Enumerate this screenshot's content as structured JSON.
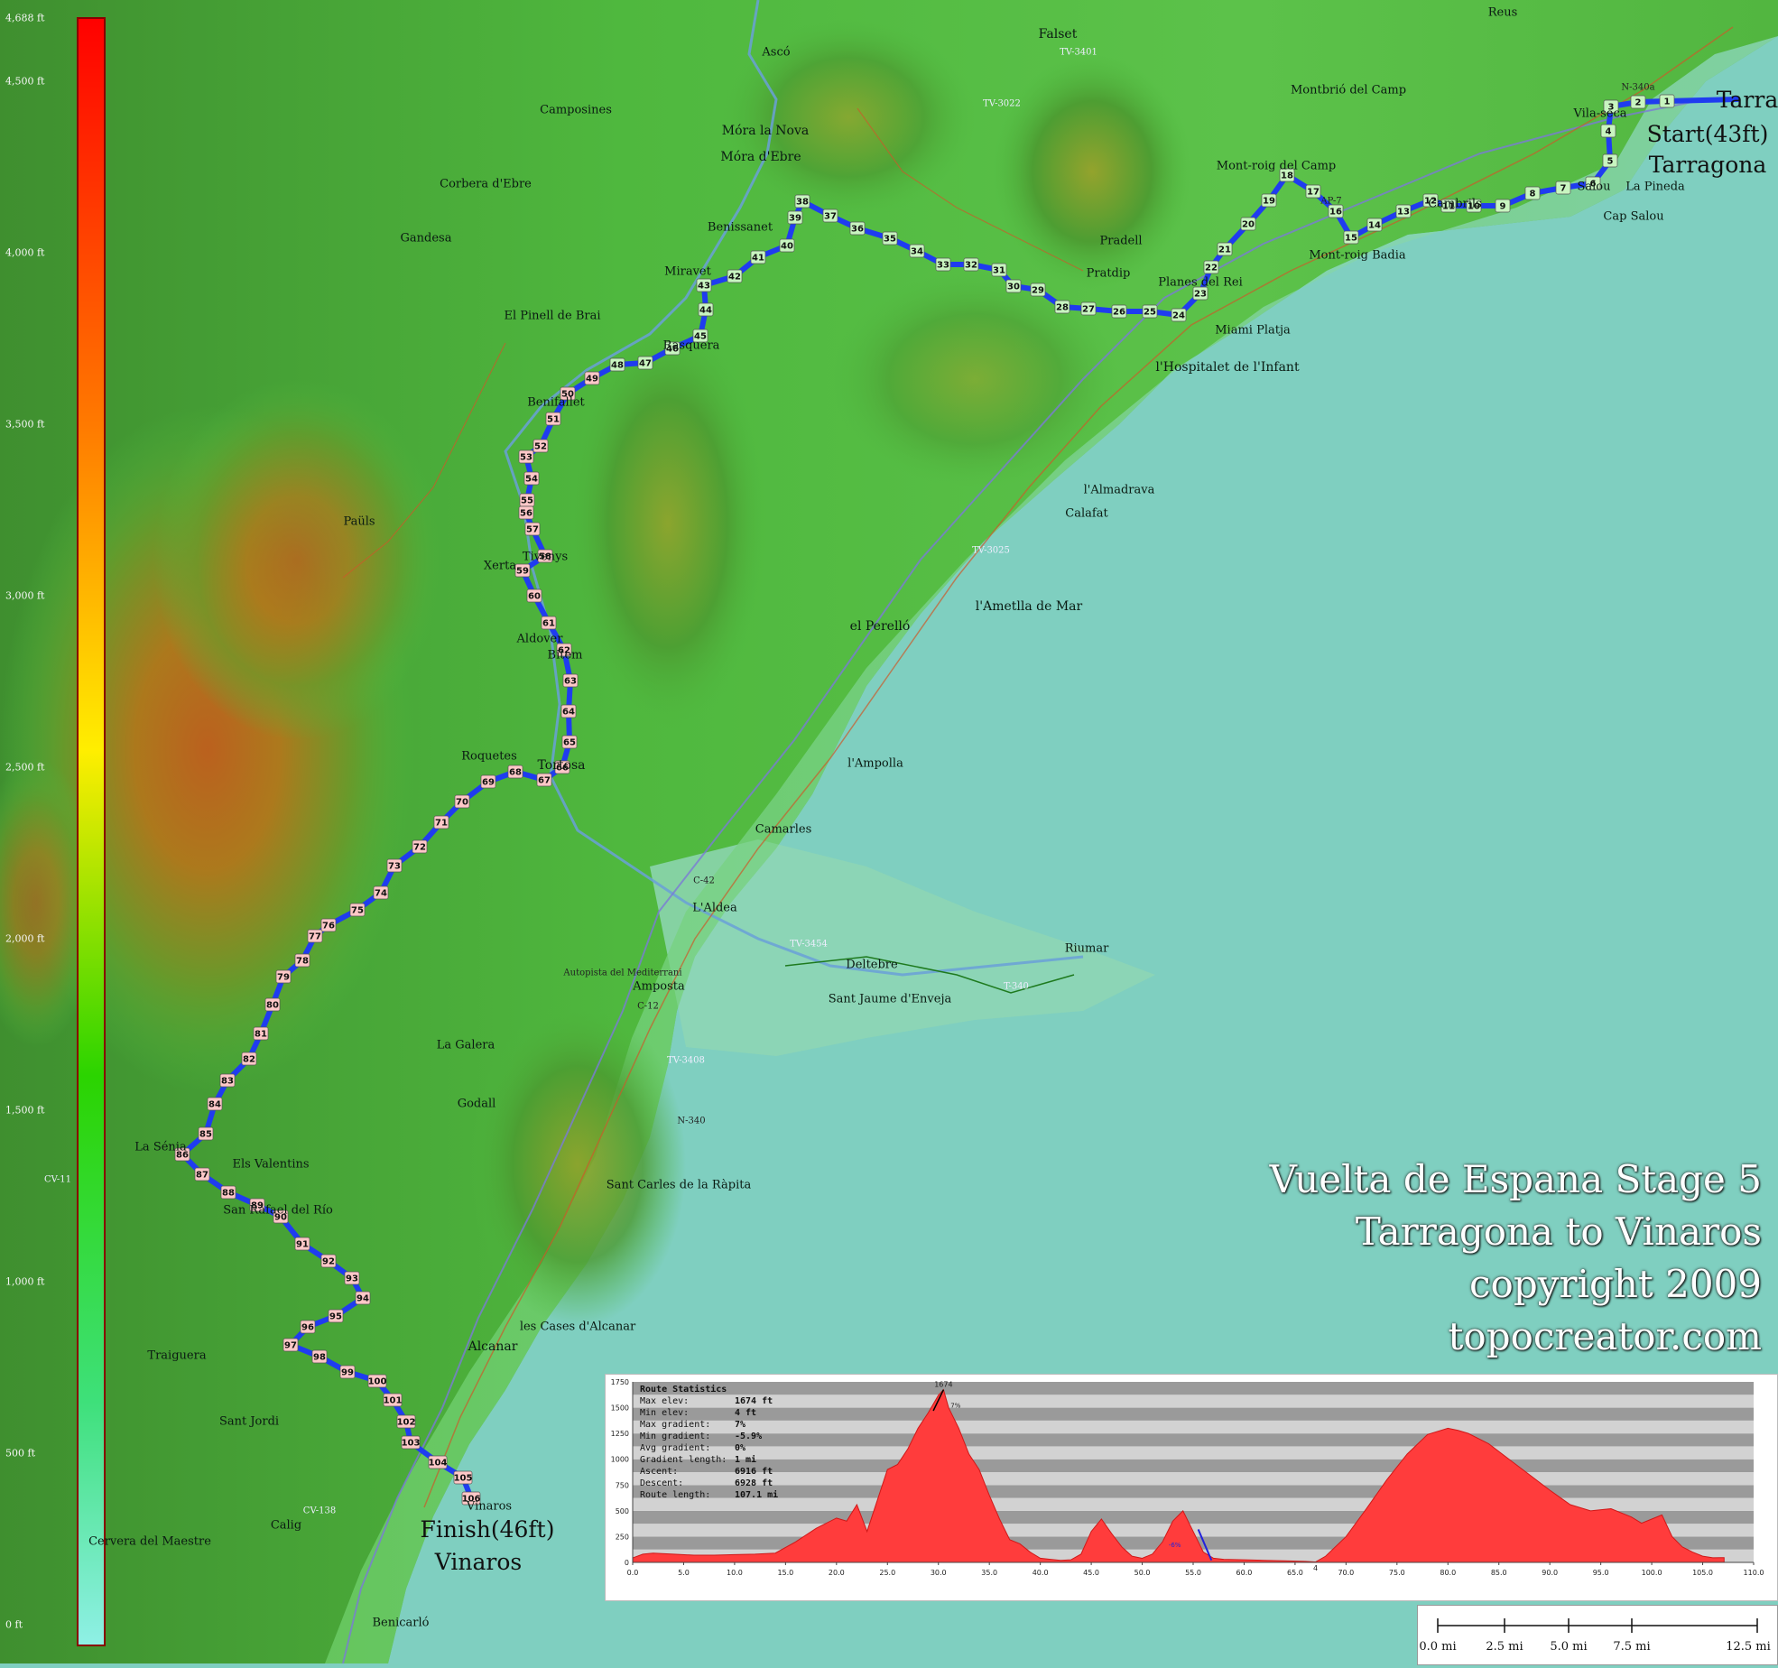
{
  "title_lines": [
    "Vuelta de Espana Stage 5",
    "Tarragona to Vinaros",
    "copyright 2009",
    "topocreator.com"
  ],
  "start": {
    "line1": "Start(43ft)",
    "line2": "Tarragona",
    "edge_label": "Tarra"
  },
  "finish": {
    "line1": "Finish(46ft)",
    "line2": "Vinaros"
  },
  "elevation_scale": [
    "4,688 ft",
    "4,500 ft",
    "4,000 ft",
    "3,500 ft",
    "3,000 ft",
    "2,500 ft",
    "2,000 ft",
    "1,500 ft",
    "1,000 ft",
    "500 ft",
    "0 ft"
  ],
  "places": [
    "Reus",
    "Falset",
    "Gandesa",
    "Corbera d'Ebre",
    "Móra la Nova",
    "Móra d'Ebre",
    "Benissanet",
    "Miravet",
    "Ascó",
    "Camposines",
    "Montbrió del Camp",
    "Mont-roig del Camp",
    "Mont-roig Badia",
    "Cambrils",
    "Salou",
    "La Pineda",
    "Cap Salou",
    "Vila-seca",
    "Pratdip",
    "Pradell",
    "Planes del Rei",
    "Miami Platja",
    "l'Hospitalet de l'Infant",
    "l'Almadrava",
    "Calafat",
    "l'Ametlla de Mar",
    "el Perelló",
    "l'Ampolla",
    "Camarles",
    "L'Aldea",
    "Amposta",
    "Deltebre",
    "Sant Jaume d'Enveja",
    "Riumar",
    "Xerta",
    "Tivenys",
    "Aldover",
    "Tortosa",
    "Bitem",
    "Roquetes",
    "Paüls",
    "Benifallet",
    "El Pinell de Brai",
    "Rasquera",
    "La Galera",
    "Godall",
    "Els Valentins",
    "La Sénia",
    "San Rafael del Río",
    "Alcanar",
    "les Cases d'Alcanar",
    "Sant Carles de la Ràpita",
    "Traiguera",
    "Sant Jordi",
    "Calig",
    "Vinaros",
    "Benicarló",
    "Cervera del Maestre"
  ],
  "road_labels": [
    "N-340",
    "N-340a",
    "C-12",
    "C-42",
    "TV-3454",
    "T-340",
    "TV-3025",
    "TV-3408",
    "AP-7",
    "Autopista del Mediterrani",
    "CV-11",
    "CV-138",
    "TV-3022",
    "TV-3401"
  ],
  "route": {
    "color": "#1f3cf0",
    "markers": [
      [
        1,
        1847,
        112
      ],
      [
        2,
        1815,
        113
      ],
      [
        3,
        1785,
        118
      ],
      [
        4,
        1782,
        145
      ],
      [
        5,
        1784,
        178
      ],
      [
        6,
        1765,
        203
      ],
      [
        7,
        1732,
        208
      ],
      [
        8,
        1698,
        214
      ],
      [
        9,
        1665,
        228
      ],
      [
        10,
        1633,
        228
      ],
      [
        11,
        1605,
        228
      ],
      [
        12,
        1585,
        222
      ],
      [
        13,
        1555,
        234
      ],
      [
        14,
        1523,
        249
      ],
      [
        15,
        1497,
        263
      ],
      [
        16,
        1480,
        234
      ],
      [
        17,
        1455,
        212
      ],
      [
        18,
        1426,
        194
      ],
      [
        19,
        1406,
        222
      ],
      [
        20,
        1383,
        248
      ],
      [
        21,
        1357,
        276
      ],
      [
        22,
        1342,
        296
      ],
      [
        23,
        1330,
        325
      ],
      [
        24,
        1306,
        349
      ],
      [
        25,
        1274,
        345
      ],
      [
        26,
        1240,
        345
      ],
      [
        27,
        1206,
        342
      ],
      [
        28,
        1177,
        340
      ],
      [
        29,
        1150,
        321
      ],
      [
        30,
        1123,
        317
      ],
      [
        31,
        1107,
        299
      ],
      [
        32,
        1076,
        293
      ],
      [
        33,
        1045,
        293
      ],
      [
        34,
        1016,
        278
      ],
      [
        35,
        986,
        264
      ],
      [
        36,
        950,
        253
      ],
      [
        37,
        920,
        239
      ],
      [
        38,
        889,
        223
      ],
      [
        39,
        881,
        241
      ],
      [
        40,
        872,
        272
      ],
      [
        41,
        840,
        285
      ],
      [
        42,
        814,
        306
      ],
      [
        43,
        780,
        316
      ],
      [
        44,
        782,
        343
      ],
      [
        45,
        776,
        372
      ],
      [
        46,
        745,
        386
      ],
      [
        47,
        715,
        402
      ],
      [
        48,
        684,
        404
      ],
      [
        49,
        656,
        419
      ],
      [
        50,
        629,
        436
      ],
      [
        51,
        613,
        464
      ],
      [
        52,
        599,
        494
      ],
      [
        53,
        583,
        506
      ],
      [
        54,
        589,
        530
      ],
      [
        55,
        584,
        554
      ],
      [
        56,
        583,
        568
      ],
      [
        57,
        590,
        586
      ],
      [
        58,
        604,
        616
      ],
      [
        59,
        579,
        632
      ],
      [
        60,
        592,
        660
      ],
      [
        61,
        608,
        690
      ],
      [
        62,
        625,
        720
      ],
      [
        63,
        632,
        754
      ],
      [
        64,
        630,
        788
      ],
      [
        65,
        631,
        822
      ],
      [
        66,
        623,
        850
      ],
      [
        67,
        603,
        864
      ],
      [
        68,
        571,
        855
      ],
      [
        69,
        541,
        866
      ],
      [
        70,
        512,
        888
      ],
      [
        71,
        489,
        911
      ],
      [
        72,
        465,
        938
      ],
      [
        73,
        437,
        959
      ],
      [
        74,
        422,
        989
      ],
      [
        75,
        396,
        1008
      ],
      [
        76,
        364,
        1025
      ],
      [
        77,
        349,
        1037
      ],
      [
        78,
        335,
        1064
      ],
      [
        79,
        314,
        1082
      ],
      [
        80,
        302,
        1113
      ],
      [
        81,
        289,
        1145
      ],
      [
        82,
        276,
        1173
      ],
      [
        83,
        252,
        1197
      ],
      [
        84,
        238,
        1223
      ],
      [
        85,
        228,
        1256
      ],
      [
        86,
        202,
        1279
      ],
      [
        87,
        224,
        1301
      ],
      [
        88,
        253,
        1321
      ],
      [
        89,
        285,
        1335
      ],
      [
        90,
        311,
        1348
      ],
      [
        91,
        335,
        1378
      ],
      [
        92,
        364,
        1397
      ],
      [
        93,
        390,
        1416
      ],
      [
        94,
        402,
        1438
      ],
      [
        95,
        372,
        1458
      ],
      [
        96,
        341,
        1470
      ],
      [
        97,
        322,
        1490
      ],
      [
        98,
        354,
        1503
      ],
      [
        99,
        385,
        1520
      ],
      [
        100,
        418,
        1530
      ],
      [
        101,
        435,
        1551
      ],
      [
        102,
        450,
        1575
      ],
      [
        103,
        455,
        1598
      ],
      [
        104,
        485,
        1620
      ],
      [
        105,
        513,
        1637
      ],
      [
        106,
        522,
        1660
      ]
    ]
  },
  "profile": {
    "title": "Route Statistics",
    "stats": [
      {
        "label": "Max elev:",
        "value": "1674 ft"
      },
      {
        "label": "Min elev:",
        "value": "4 ft"
      },
      {
        "label": "Max gradient:",
        "value": "7%"
      },
      {
        "label": "Min gradient:",
        "value": "-5.9%"
      },
      {
        "label": "Avg gradient:",
        "value": "0%"
      },
      {
        "label": "Gradient length:",
        "value": "1 mi"
      },
      {
        "label": "Ascent:",
        "value": "6916 ft"
      },
      {
        "label": "Descent:",
        "value": "6928 ft"
      },
      {
        "label": "Route length:",
        "value": "107.1 mi"
      }
    ],
    "annotations": {
      "max": "1674",
      "min": "4",
      "max_grad": "7%",
      "min_grad": "-6%"
    },
    "fill_color": "#ff3c3c"
  },
  "chart_data": {
    "type": "area",
    "xlim": [
      0,
      110
    ],
    "ylim": [
      0,
      1750
    ],
    "xticks": [
      "0.0",
      "5.0",
      "10.0",
      "15.0",
      "20.0",
      "25.0",
      "30.0",
      "35.0",
      "40.0",
      "45.0",
      "50.0",
      "55.0",
      "60.0",
      "65.0",
      "70.0",
      "75.0",
      "80.0",
      "85.0",
      "90.0",
      "95.0",
      "100.0",
      "105.0",
      "110.0"
    ],
    "yticks": [
      "1750",
      "1500",
      "1250",
      "1000",
      "750",
      "500",
      "250",
      "0"
    ],
    "x": [
      0,
      1,
      2,
      4,
      6,
      8,
      10,
      12,
      14,
      16,
      18,
      20,
      21,
      22,
      23,
      24,
      25,
      26,
      27,
      28,
      29,
      30,
      30.5,
      31,
      32,
      33,
      34,
      35,
      36,
      37,
      38,
      39,
      40,
      41,
      42,
      43,
      44,
      45,
      46,
      47,
      48,
      49,
      50,
      51,
      52,
      53,
      54,
      55,
      56,
      57,
      58,
      60,
      62,
      64,
      66,
      67,
      68,
      70,
      72,
      74,
      76,
      78,
      80,
      81,
      82,
      84,
      86,
      88,
      90,
      92,
      94,
      96,
      98,
      99,
      100,
      101,
      102,
      103,
      104,
      105,
      106,
      107.1
    ],
    "y": [
      43,
      80,
      90,
      80,
      70,
      70,
      75,
      80,
      90,
      200,
      330,
      430,
      400,
      560,
      300,
      600,
      900,
      950,
      1100,
      1300,
      1450,
      1620,
      1674,
      1500,
      1300,
      1050,
      900,
      650,
      420,
      220,
      180,
      100,
      40,
      30,
      20,
      25,
      80,
      300,
      420,
      280,
      150,
      60,
      40,
      80,
      200,
      400,
      500,
      300,
      100,
      40,
      30,
      25,
      20,
      15,
      10,
      4,
      60,
      250,
      520,
      800,
      1050,
      1240,
      1300,
      1280,
      1250,
      1150,
      1000,
      850,
      700,
      560,
      500,
      520,
      440,
      380,
      420,
      460,
      250,
      150,
      100,
      60,
      45,
      46
    ]
  },
  "scalebar": {
    "labels": [
      "0.0 mi",
      "2.5 mi",
      "5.0 mi",
      "7.5 mi",
      "12.5 mi"
    ]
  }
}
